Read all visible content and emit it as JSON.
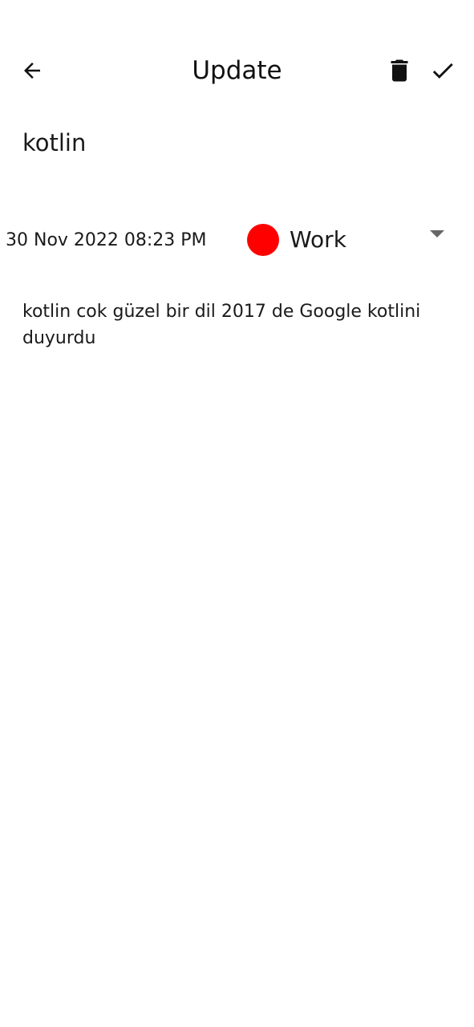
{
  "header": {
    "title": "Update",
    "back_icon": "arrow-left-icon",
    "delete_icon": "trash-icon",
    "save_icon": "check-icon"
  },
  "note": {
    "title": "kotlin",
    "date": "30 Nov 2022 08:23 PM",
    "category": {
      "label": "Work",
      "color": "#ff0000"
    },
    "content": "kotlin cok güzel bir dil 2017 de Google kotlini duyurdu"
  }
}
